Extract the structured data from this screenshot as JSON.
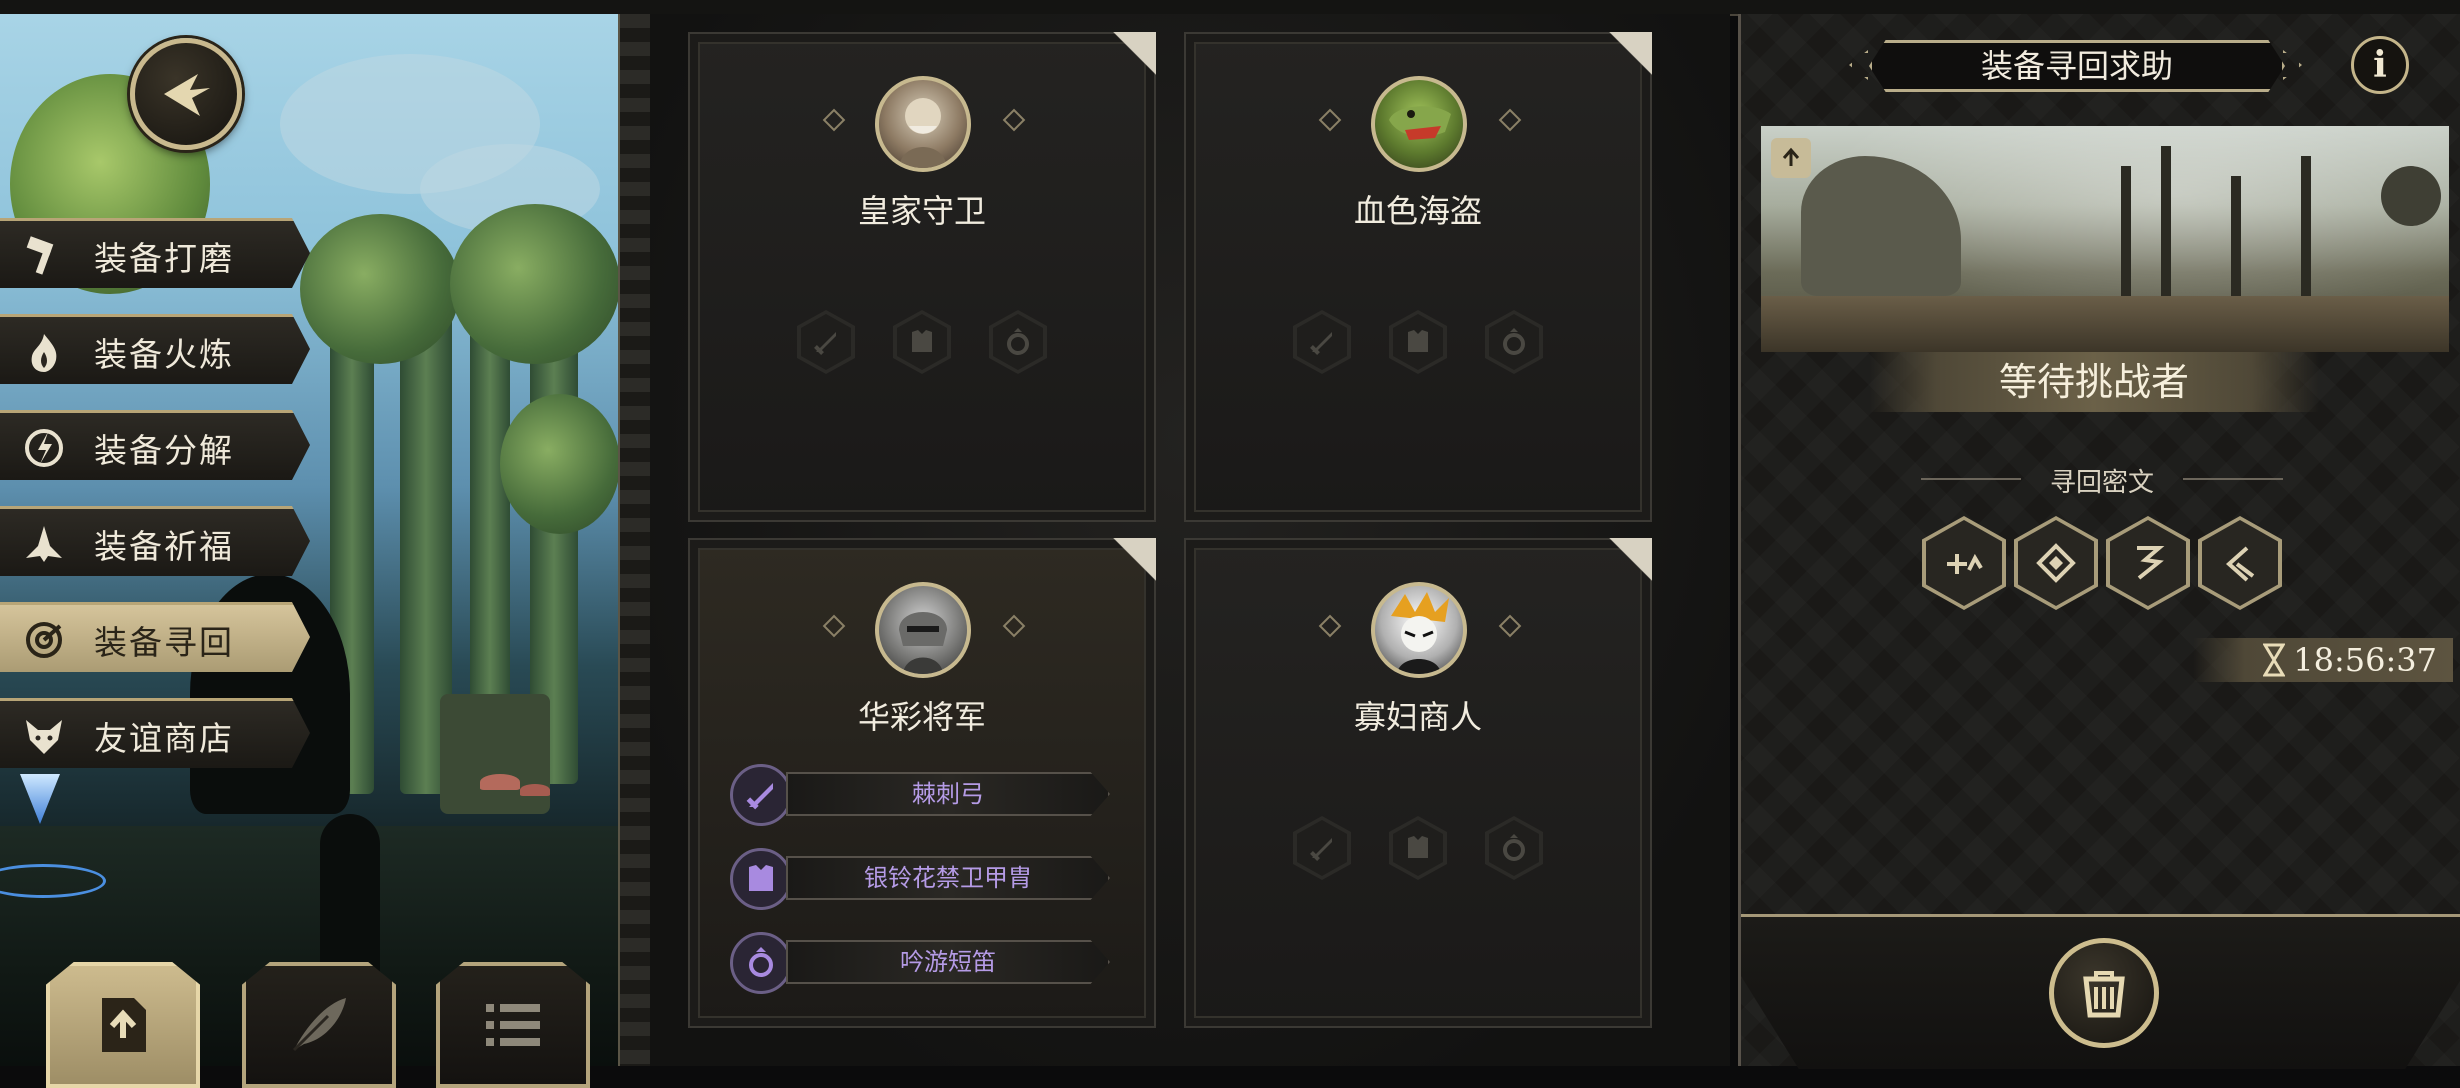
{
  "menu": {
    "items": [
      {
        "label": "装备打磨",
        "icon": "hammer-icon",
        "active": false
      },
      {
        "label": "装备火炼",
        "icon": "flame-icon",
        "active": false
      },
      {
        "label": "装备分解",
        "icon": "disassemble-icon",
        "active": false
      },
      {
        "label": "装备祈福",
        "icon": "pray-hands-icon",
        "active": false
      },
      {
        "label": "装备寻回",
        "icon": "target-icon",
        "active": true
      },
      {
        "label": "友谊商店",
        "icon": "fox-icon",
        "active": false
      }
    ]
  },
  "bottom_buttons": [
    {
      "icon": "upload-doc-icon",
      "active": true
    },
    {
      "icon": "feather-icon",
      "active": false
    },
    {
      "icon": "list-icon",
      "active": false
    }
  ],
  "cards": [
    {
      "name": "皇家守卫",
      "avatar": "royal-guard-portrait",
      "equipment": []
    },
    {
      "name": "血色海盗",
      "avatar": "blood-pirate-portrait",
      "equipment": []
    },
    {
      "name": "华彩将军",
      "avatar": "general-portrait",
      "equipment": [
        {
          "label": "棘刺弓",
          "icon": "sword-icon"
        },
        {
          "label": "银铃花禁卫甲胄",
          "icon": "armor-icon"
        },
        {
          "label": "吟游短笛",
          "icon": "ring-icon"
        }
      ]
    },
    {
      "name": "寡妇商人",
      "avatar": "widow-merchant-portrait",
      "equipment": []
    }
  ],
  "right_panel": {
    "title": "装备寻回求助",
    "info_label": "i",
    "status": "等待挑战者",
    "secret_label": "寻回密文",
    "secret_glyphs": [
      "glyph-1-icon",
      "glyph-2-icon",
      "glyph-3-icon",
      "glyph-4-icon"
    ],
    "timer": "18:56:37"
  },
  "colors": {
    "gold": "#c9b98e",
    "purple_text": "#b59be6",
    "panel_bg": "#1a1917"
  }
}
